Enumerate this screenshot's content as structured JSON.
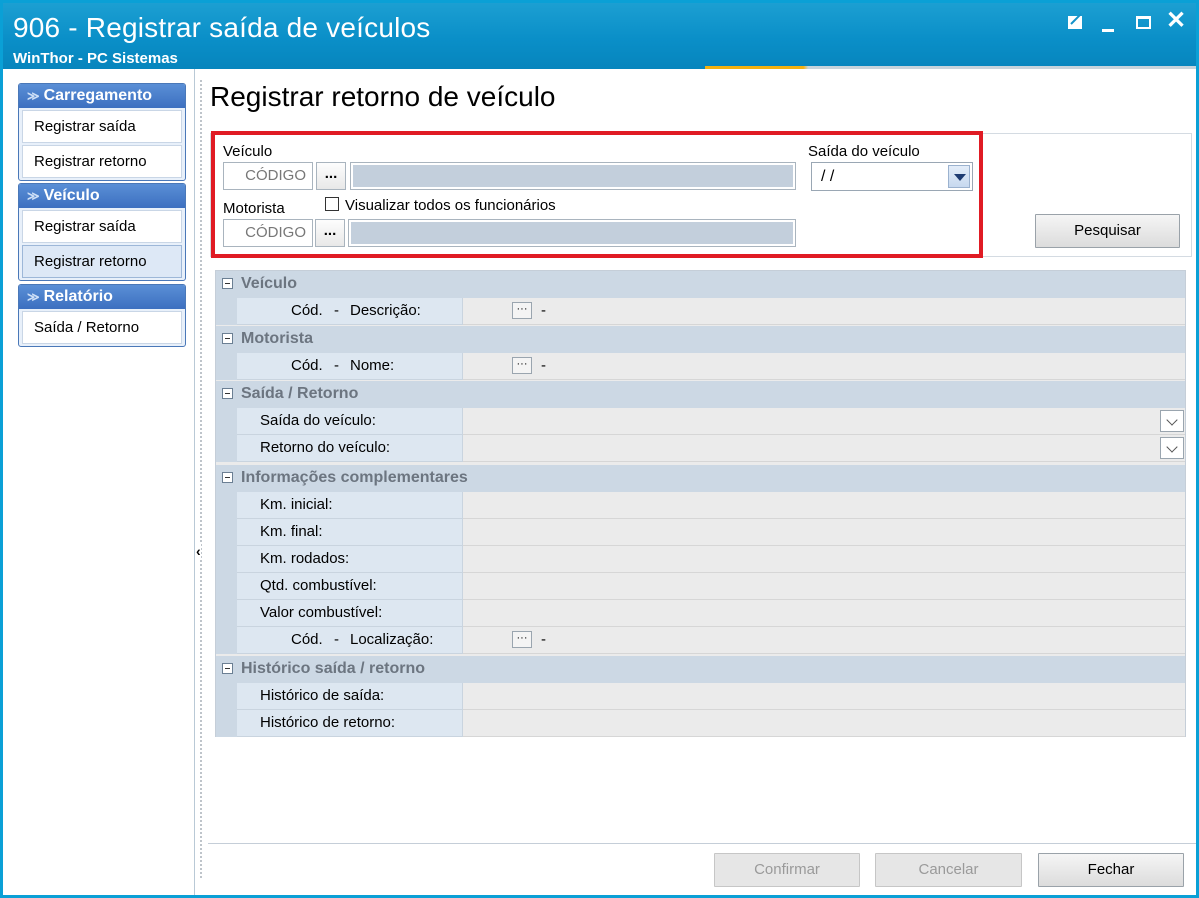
{
  "window": {
    "title": "906 - Registrar saída de veículos",
    "subtitle": "WinThor - PC Sistemas",
    "buttons": {
      "minimize": "_",
      "close": "✕"
    }
  },
  "sidebar": {
    "groups": [
      {
        "title": "Carregamento",
        "items": [
          "Registrar saída",
          "Registrar retorno"
        ]
      },
      {
        "title": "Veículo",
        "items": [
          "Registrar saída",
          "Registrar retorno"
        ]
      },
      {
        "title": "Relatório",
        "items": [
          "Saída / Retorno"
        ]
      }
    ],
    "selected": "Veículo > Registrar retorno"
  },
  "main": {
    "page_title": "Registrar retorno de veículo",
    "filter": {
      "veiculo_label": "Veículo",
      "veiculo_code_placeholder": "CÓDIGO",
      "ellipsis": "...",
      "saida_label": "Saída do veículo",
      "saida_value": " / /",
      "motorista_label": "Motorista",
      "motorista_code_placeholder": "CÓDIGO",
      "visualizar_label": "Visualizar todos os funcionários",
      "visualizar_checked": false,
      "pesquisar": "Pesquisar"
    },
    "grid": {
      "veiculo": {
        "title": "Veículo",
        "cod": "Cód.",
        "dash": "-",
        "desc": "Descrição:",
        "value_dash": "-",
        "btn": "···"
      },
      "motorista": {
        "title": "Motorista",
        "cod": "Cód.",
        "dash": "-",
        "nome": "Nome:",
        "value_dash": "-",
        "btn": "···"
      },
      "saida_retorno": {
        "title": "Saída / Retorno",
        "saida": "Saída do veículo:",
        "retorno": "Retorno do veículo:"
      },
      "info": {
        "title": "Informações complementares",
        "km_inicial": "Km. inicial:",
        "km_final": "Km. final:",
        "km_rodados": "Km. rodados:",
        "qtd_comb": "Qtd. combustível:",
        "valor_comb": "Valor combustível:",
        "cod": "Cód.",
        "dash": "-",
        "localizacao": "Localização:",
        "value_dash": "-",
        "btn": "···"
      },
      "historico": {
        "title": "Histórico saída / retorno",
        "saida": "Histórico de saída:",
        "retorno": "Histórico de retorno:"
      }
    },
    "buttons": {
      "confirmar": "Confirmar",
      "cancelar": "Cancelar",
      "fechar": "Fechar"
    }
  },
  "colors": {
    "titlebar": "#0a8fc8",
    "highlight": "#e01b24",
    "group_header": "#3c6fc0"
  }
}
